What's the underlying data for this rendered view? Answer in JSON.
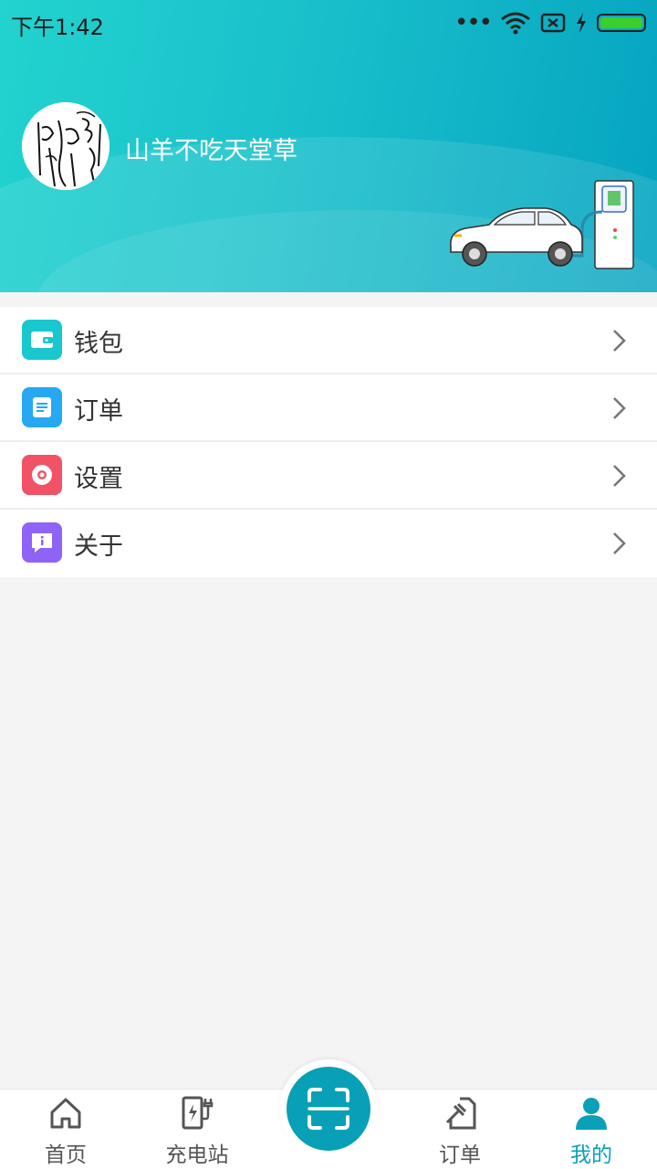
{
  "status_bar": {
    "time": "下午1:42"
  },
  "profile": {
    "username": "山羊不吃天堂草"
  },
  "menu": {
    "items": [
      {
        "label": "钱包",
        "icon": "wallet-icon",
        "color": "#19c7cf"
      },
      {
        "label": "订单",
        "icon": "order-list-icon",
        "color": "#26a9f2"
      },
      {
        "label": "设置",
        "icon": "settings-icon",
        "color": "#f25266"
      },
      {
        "label": "关于",
        "icon": "about-icon",
        "color": "#8f63f5"
      }
    ]
  },
  "bottom_nav": {
    "items": [
      {
        "label": "首页",
        "icon": "home-icon"
      },
      {
        "label": "充电站",
        "icon": "charging-station-icon"
      },
      {
        "label": "订单",
        "icon": "order-icon"
      },
      {
        "label": "我的",
        "icon": "person-icon",
        "active": true
      }
    ],
    "center_action": {
      "icon": "scan-icon"
    }
  },
  "colors": {
    "accent": "#08a0b6",
    "header_start": "#22d3cf",
    "header_end": "#05a4c1"
  }
}
